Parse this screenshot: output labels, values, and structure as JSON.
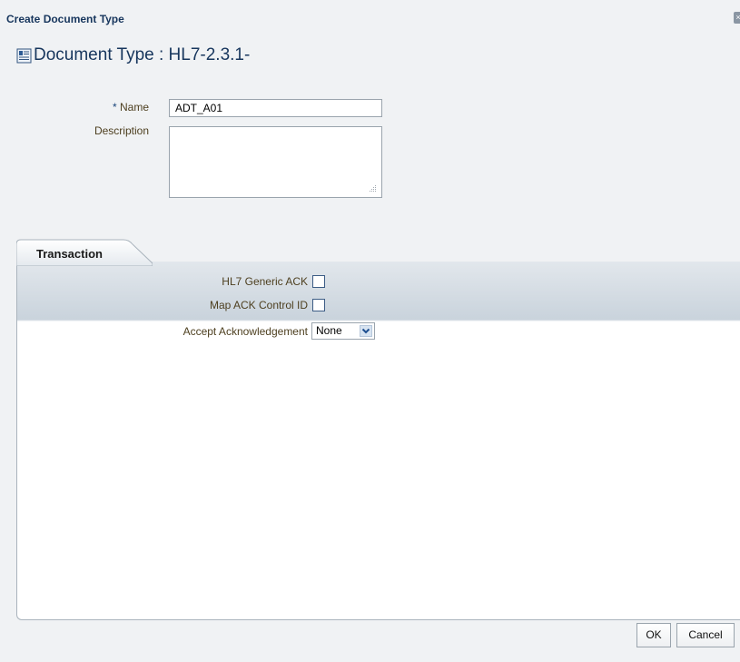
{
  "dialog": {
    "title": "Create Document Type",
    "close_label": "×"
  },
  "heading": {
    "text": "Document Type : HL7-2.3.1-",
    "icon": "document-type-icon"
  },
  "form": {
    "name_label": "Name",
    "required_marker": "*",
    "name_value": "ADT_A01",
    "description_label": "Description",
    "description_value": ""
  },
  "tabs": [
    {
      "label": "Transaction",
      "active": true
    }
  ],
  "transaction": {
    "hl7_generic_ack_label": "HL7 Generic ACK",
    "hl7_generic_ack_checked": false,
    "map_ack_control_id_label": "Map ACK Control ID",
    "map_ack_control_id_checked": false,
    "accept_ack_label": "Accept Acknowledgement",
    "accept_ack_value": "None"
  },
  "buttons": {
    "ok_label": "OK",
    "cancel_label": "Cancel"
  },
  "colors": {
    "title": "#17365d",
    "label": "#4d3f1f",
    "panel_header": "#c9d3dc"
  }
}
